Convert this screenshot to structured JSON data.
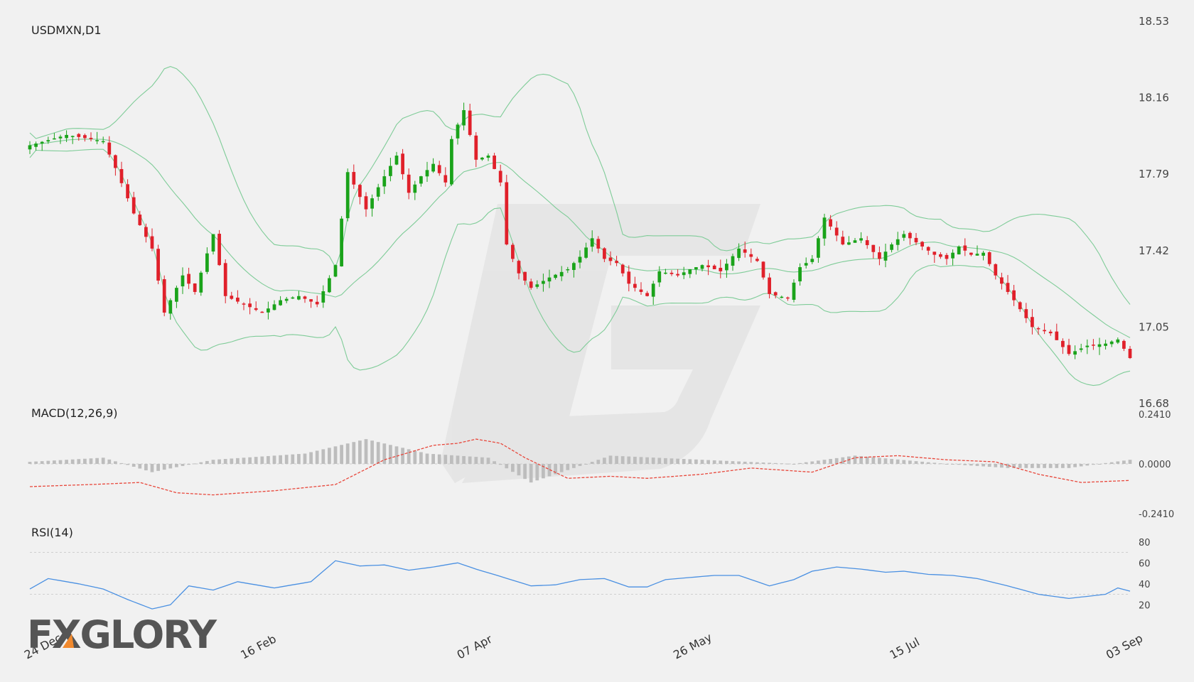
{
  "chart_data": [
    {
      "type": "candlestick",
      "title": "USDMXN,D1",
      "y_ticks": [
        "18.53",
        "18.16",
        "17.79",
        "17.42",
        "17.05",
        "16.68"
      ],
      "ylim": [
        16.68,
        18.53
      ],
      "x_labels": [
        "24 Dec",
        "16 Feb",
        "07 Apr",
        "26 May",
        "15 Jul",
        "03 Sep"
      ],
      "colors": {
        "up": "#1aa31a",
        "down": "#e0202a",
        "bands": "#7fcc98"
      },
      "indicators": [
        "Bollinger Bands (upper, middle, lower)"
      ],
      "close_anchors": [
        [
          0,
          17.93
        ],
        [
          6,
          17.98
        ],
        [
          10,
          17.96
        ],
        [
          12,
          17.95
        ],
        [
          14,
          17.82
        ],
        [
          17,
          17.6
        ],
        [
          20,
          17.43
        ],
        [
          22,
          17.12
        ],
        [
          25,
          17.3
        ],
        [
          27,
          17.22
        ],
        [
          30,
          17.5
        ],
        [
          32,
          17.2
        ],
        [
          35,
          17.16
        ],
        [
          38,
          17.12
        ],
        [
          41,
          17.18
        ],
        [
          44,
          17.2
        ],
        [
          47,
          17.16
        ],
        [
          50,
          17.35
        ],
        [
          52,
          17.8
        ],
        [
          55,
          17.62
        ],
        [
          58,
          17.78
        ],
        [
          60,
          17.88
        ],
        [
          62,
          17.7
        ],
        [
          64,
          17.78
        ],
        [
          66,
          17.84
        ],
        [
          68,
          17.75
        ],
        [
          69,
          17.96
        ],
        [
          71,
          18.1
        ],
        [
          73,
          17.86
        ],
        [
          75,
          17.88
        ],
        [
          77,
          17.75
        ],
        [
          78,
          17.45
        ],
        [
          80,
          17.31
        ],
        [
          82,
          17.24
        ],
        [
          85,
          17.29
        ],
        [
          88,
          17.33
        ],
        [
          90,
          17.39
        ],
        [
          92,
          17.48
        ],
        [
          94,
          17.38
        ],
        [
          96,
          17.36
        ],
        [
          98,
          17.26
        ],
        [
          101,
          17.2
        ],
        [
          103,
          17.32
        ],
        [
          106,
          17.3
        ],
        [
          108,
          17.33
        ],
        [
          110,
          17.35
        ],
        [
          113,
          17.32
        ],
        [
          116,
          17.43
        ],
        [
          119,
          17.37
        ],
        [
          121,
          17.21
        ],
        [
          124,
          17.19
        ],
        [
          126,
          17.34
        ],
        [
          128,
          17.38
        ],
        [
          130,
          17.58
        ],
        [
          133,
          17.45
        ],
        [
          136,
          17.48
        ],
        [
          139,
          17.38
        ],
        [
          141,
          17.45
        ],
        [
          143,
          17.5
        ],
        [
          145,
          17.46
        ],
        [
          148,
          17.4
        ],
        [
          150,
          17.38
        ],
        [
          152,
          17.44
        ],
        [
          154,
          17.4
        ],
        [
          156,
          17.41
        ],
        [
          158,
          17.3
        ],
        [
          161,
          17.18
        ],
        [
          164,
          17.05
        ],
        [
          167,
          17.02
        ],
        [
          170,
          16.92
        ],
        [
          173,
          16.96
        ],
        [
          176,
          16.97
        ],
        [
          178,
          16.99
        ],
        [
          180,
          16.9
        ]
      ]
    },
    {
      "type": "line",
      "title": "MACD(12,26,9)",
      "y_ticks": [
        "0.2410",
        "0.0000",
        "-0.2410"
      ],
      "ylim": [
        -0.241,
        0.241
      ],
      "series": [
        {
          "role": "histogram",
          "color": "#bdbdbd",
          "anchors": [
            [
              0,
              0.01
            ],
            [
              12,
              0.03
            ],
            [
              20,
              -0.04
            ],
            [
              30,
              0.02
            ],
            [
              45,
              0.05
            ],
            [
              55,
              0.12
            ],
            [
              65,
              0.05
            ],
            [
              75,
              0.03
            ],
            [
              82,
              -0.09
            ],
            [
              95,
              0.04
            ],
            [
              110,
              0.02
            ],
            [
              125,
              0.0
            ],
            [
              135,
              0.04
            ],
            [
              150,
              0.0
            ],
            [
              160,
              -0.02
            ],
            [
              170,
              -0.02
            ],
            [
              180,
              0.02
            ]
          ]
        },
        {
          "role": "signal",
          "color": "#e8473b",
          "anchors": [
            [
              0,
              -0.11
            ],
            [
              10,
              -0.1
            ],
            [
              18,
              -0.09
            ],
            [
              24,
              -0.14
            ],
            [
              30,
              -0.15
            ],
            [
              40,
              -0.13
            ],
            [
              50,
              -0.1
            ],
            [
              58,
              0.02
            ],
            [
              66,
              0.09
            ],
            [
              70,
              0.1
            ],
            [
              73,
              0.12
            ],
            [
              77,
              0.1
            ],
            [
              81,
              0.03
            ],
            [
              88,
              -0.07
            ],
            [
              95,
              -0.06
            ],
            [
              101,
              -0.07
            ],
            [
              110,
              -0.05
            ],
            [
              118,
              -0.02
            ],
            [
              128,
              -0.04
            ],
            [
              135,
              0.03
            ],
            [
              142,
              0.04
            ],
            [
              150,
              0.02
            ],
            [
              158,
              0.01
            ],
            [
              165,
              -0.05
            ],
            [
              172,
              -0.09
            ],
            [
              180,
              -0.08
            ]
          ]
        }
      ]
    },
    {
      "type": "line",
      "title": "RSI(14)",
      "y_ticks": [
        "80",
        "60",
        "40",
        "20"
      ],
      "ylim": [
        0,
        100
      ],
      "guide_levels": [
        70,
        30
      ],
      "series": [
        {
          "color": "#4a90e2",
          "anchors": [
            [
              0,
              35
            ],
            [
              3,
              45
            ],
            [
              8,
              40
            ],
            [
              12,
              35
            ],
            [
              16,
              25
            ],
            [
              20,
              16
            ],
            [
              23,
              20
            ],
            [
              26,
              38
            ],
            [
              30,
              34
            ],
            [
              34,
              42
            ],
            [
              40,
              36
            ],
            [
              46,
              42
            ],
            [
              50,
              62
            ],
            [
              54,
              57
            ],
            [
              58,
              58
            ],
            [
              62,
              53
            ],
            [
              66,
              56
            ],
            [
              70,
              60
            ],
            [
              73,
              54
            ],
            [
              77,
              47
            ],
            [
              82,
              38
            ],
            [
              86,
              39
            ],
            [
              90,
              44
            ],
            [
              94,
              45
            ],
            [
              98,
              37
            ],
            [
              101,
              37
            ],
            [
              104,
              44
            ],
            [
              108,
              46
            ],
            [
              112,
              48
            ],
            [
              116,
              48
            ],
            [
              121,
              38
            ],
            [
              125,
              44
            ],
            [
              128,
              52
            ],
            [
              132,
              56
            ],
            [
              136,
              54
            ],
            [
              140,
              51
            ],
            [
              143,
              52
            ],
            [
              147,
              49
            ],
            [
              151,
              48
            ],
            [
              155,
              45
            ],
            [
              160,
              38
            ],
            [
              165,
              30
            ],
            [
              170,
              26
            ],
            [
              173,
              28
            ],
            [
              176,
              30
            ],
            [
              178,
              36
            ],
            [
              180,
              33
            ]
          ]
        }
      ]
    }
  ],
  "logo": {
    "text": "FXGLORY"
  }
}
